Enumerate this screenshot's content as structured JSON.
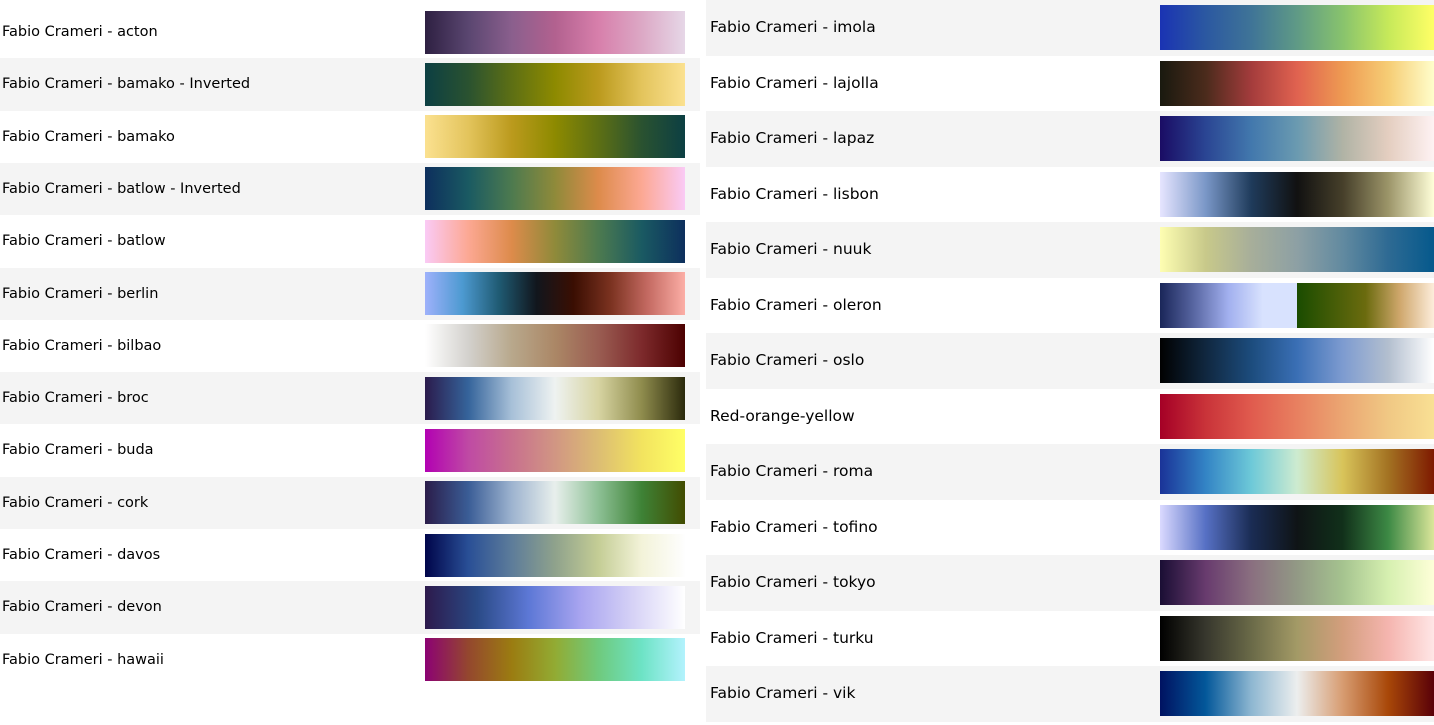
{
  "columns": [
    {
      "items": [
        {
          "label": "Fabio Crameri - acton",
          "stops": [
            "#2e2042",
            "#5a4670",
            "#8a5f8d",
            "#b2618f",
            "#d77fab",
            "#dca8c5",
            "#e6d7e7"
          ]
        },
        {
          "label": "Fabio Crameri - bamako - Inverted",
          "stops": [
            "#0c3f43",
            "#2a5230",
            "#5d6f14",
            "#8d8a00",
            "#bb9a1d",
            "#e3c45c",
            "#fbe190"
          ]
        },
        {
          "label": "Fabio Crameri - bamako",
          "stops": [
            "#fbe190",
            "#e3c45c",
            "#bb9a1d",
            "#8d8a00",
            "#5d6f14",
            "#2a5230",
            "#0c3f43"
          ]
        },
        {
          "label": "Fabio Crameri - batlow - Inverted",
          "stops": [
            "#0d2f5d",
            "#1a5a62",
            "#4d7a4f",
            "#8f8a3a",
            "#dd8b4b",
            "#fca893",
            "#facaf5"
          ]
        },
        {
          "label": "Fabio Crameri - batlow",
          "stops": [
            "#facaf5",
            "#fca893",
            "#dd8b4b",
            "#8f8a3a",
            "#4d7a4f",
            "#1a5a62",
            "#0d2f5d"
          ]
        },
        {
          "label": "Fabio Crameri - berlin",
          "stops": [
            "#9eb1fb",
            "#4d9ad1",
            "#1f5a72",
            "#11161d",
            "#3a0e02",
            "#7b3220",
            "#c46a62",
            "#fcaea6"
          ]
        },
        {
          "label": "Fabio Crameri - bilbao",
          "stops": [
            "#ffffff",
            "#d3d1cd",
            "#b8a88c",
            "#ab8766",
            "#9a5d52",
            "#7d2a2c",
            "#4c0101"
          ]
        },
        {
          "label": "Fabio Crameri - broc",
          "stops": [
            "#2b1b4c",
            "#35649b",
            "#a7c0d8",
            "#eef2f1",
            "#d7d4a2",
            "#8f8c4d",
            "#2b2a0c"
          ]
        },
        {
          "label": "Fabio Crameri - buda",
          "stops": [
            "#b201b2",
            "#bf4aa4",
            "#c8708e",
            "#d19683",
            "#dcbd73",
            "#f2e35f",
            "#ffff66"
          ]
        },
        {
          "label": "Fabio Crameri - cork",
          "stops": [
            "#2b1d4a",
            "#3a5d96",
            "#9db3cf",
            "#e8efec",
            "#8dc095",
            "#3e8236",
            "#424c01"
          ]
        },
        {
          "label": "Fabio Crameri - davos",
          "stops": [
            "#00054a",
            "#294f96",
            "#5d7c9a",
            "#8fa28c",
            "#c4cd95",
            "#f3f3d9",
            "#fefefe"
          ]
        },
        {
          "label": "Fabio Crameri - devon",
          "stops": [
            "#2d1a4c",
            "#2a4a86",
            "#5d78d6",
            "#a9a5f0",
            "#d6d2f6",
            "#ffffff"
          ]
        },
        {
          "label": "Fabio Crameri - hawaii",
          "stops": [
            "#8c0273",
            "#94472e",
            "#9b7c11",
            "#92ab33",
            "#6fca7d",
            "#6de3c5",
            "#b3f2fd"
          ]
        }
      ]
    },
    {
      "items": [
        {
          "label": "Fabio Crameri - imola",
          "stops": [
            "#1a33b3",
            "#2b58a1",
            "#3f7497",
            "#5f9a86",
            "#88c36d",
            "#c6e95a",
            "#ffff66"
          ]
        },
        {
          "label": "Fabio Crameri - lajolla",
          "stops": [
            "#19190f",
            "#4b2b1c",
            "#a43c3c",
            "#e06250",
            "#ee9a52",
            "#f6cd75",
            "#fffecb"
          ]
        },
        {
          "label": "Fabio Crameri - lapaz",
          "stops": [
            "#1a0c64",
            "#2a4593",
            "#4278ad",
            "#6a9ab0",
            "#b0b3a5",
            "#e4cec0",
            "#fef2f3"
          ]
        },
        {
          "label": "Fabio Crameri - lisbon",
          "stops": [
            "#e6e5ff",
            "#7a97c7",
            "#1f3b5b",
            "#111111",
            "#463f2a",
            "#9c9569",
            "#ffffd9"
          ]
        },
        {
          "label": "Fabio Crameri - nuuk",
          "stops": [
            "#fefeb2",
            "#c8c98a",
            "#a7ae9a",
            "#8da0a4",
            "#628aa0",
            "#2e6a93",
            "#05598c"
          ]
        },
        {
          "label": "Fabio Crameri - oleron",
          "stops": [
            "#1a2659",
            "#5967a3",
            "#a2b0ef",
            "#d8e2fe",
            "#d8e2fe|0.5",
            "#1a4c00|0.5",
            "#6b6b0e",
            "#cfa76c",
            "#fdeddb"
          ]
        },
        {
          "label": "Fabio Crameri - oslo",
          "stops": [
            "#010101",
            "#10273f",
            "#1c4c7d",
            "#3a6fb5",
            "#7d9bd0",
            "#b3bfcf",
            "#ffffff"
          ]
        },
        {
          "label": "Red-orange-yellow",
          "stops": [
            "#a50026",
            "#c93339",
            "#e05b4e",
            "#e88060",
            "#eba672",
            "#f0c884",
            "#f9e094"
          ]
        },
        {
          "label": "Fabio Crameri - roma",
          "stops": [
            "#1a3398",
            "#3384c5",
            "#6dc9d8",
            "#cdebd0",
            "#d8c45a",
            "#a37222",
            "#7e1900"
          ]
        },
        {
          "label": "Fabio Crameri - tofino",
          "stops": [
            "#dad9ff",
            "#5670c4",
            "#1a2c54",
            "#0f1416",
            "#11301a",
            "#3d8a45",
            "#dbe69a"
          ]
        },
        {
          "label": "Fabio Crameri - tokyo",
          "stops": [
            "#1a0e34",
            "#683b6e",
            "#8a6f80",
            "#929985",
            "#a5c38f",
            "#d6f0b0",
            "#feffd8"
          ]
        },
        {
          "label": "Fabio Crameri - turku",
          "stops": [
            "#000000",
            "#37372d",
            "#6a6a48",
            "#a39a66",
            "#d39e7d",
            "#f5b5af",
            "#ffe6e6"
          ]
        },
        {
          "label": "Fabio Crameri - vik",
          "stops": [
            "#001261",
            "#03589a",
            "#8eb7d1",
            "#eceeee",
            "#d79c71",
            "#a84708",
            "#590008"
          ]
        }
      ]
    }
  ]
}
